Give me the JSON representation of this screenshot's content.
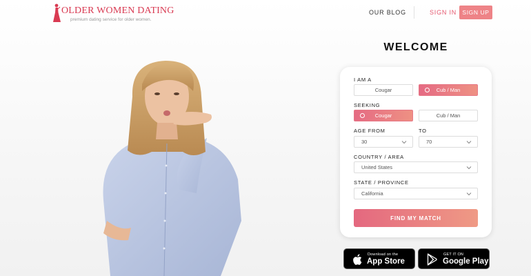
{
  "header": {
    "logo_title": "OLDER WOMEN DATING",
    "logo_tagline": "premium dating service for older women.",
    "nav": {
      "blog": "OUR BLOG",
      "signin": "SIGN IN",
      "signup": "SIGN UP"
    },
    "brand_color": "#d93a52",
    "accent_color": "#ee8387"
  },
  "form": {
    "welcome": "WELCOME",
    "i_am": {
      "label": "I AM A",
      "options": [
        "Cougar",
        "Cub / Man"
      ],
      "selected": "Cub / Man"
    },
    "seeking": {
      "label": "SEEKING",
      "options": [
        "Cougar",
        "Cub / Man"
      ],
      "selected": "Cougar"
    },
    "age_from": {
      "label": "AGE FROM",
      "value": "30"
    },
    "age_to": {
      "label": "TO",
      "value": "70"
    },
    "country": {
      "label": "COUNTRY / AREA",
      "value": "United States"
    },
    "state": {
      "label": "STATE / PROVINCE",
      "value": "California"
    },
    "submit": "FIND MY MATCH"
  },
  "badges": {
    "appstore": {
      "small": "Download on the",
      "big": "App Store"
    },
    "googleplay": {
      "small": "GET IT ON",
      "big": "Google Play"
    }
  }
}
